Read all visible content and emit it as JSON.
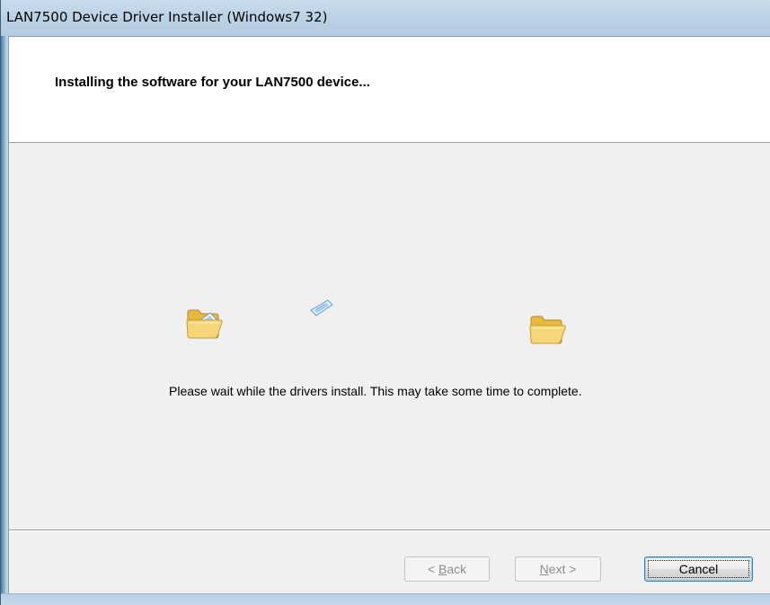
{
  "window": {
    "title": "LAN7500 Device Driver Installer (Windows7 32)"
  },
  "header": {
    "title": "Installing the software for your LAN7500 device..."
  },
  "main": {
    "message": "Please wait while the drivers install. This may take some time to complete.",
    "animation": {
      "source_icon": "open-folder-icon",
      "flying_icon": "document-icon",
      "destination_icon": "open-folder-icon"
    }
  },
  "buttons": {
    "back": {
      "pre": "< ",
      "mnemonic": "B",
      "rest": "ack",
      "enabled": false
    },
    "next": {
      "mnemonic": "N",
      "rest": "ext >",
      "enabled": false
    },
    "cancel": {
      "label": "Cancel",
      "enabled": true
    }
  },
  "colors": {
    "title_bar": "#bcd3e6",
    "dialog_background": "#f0f0f0",
    "header_background": "#ffffff",
    "folder_yellow": "#f5d77a"
  }
}
